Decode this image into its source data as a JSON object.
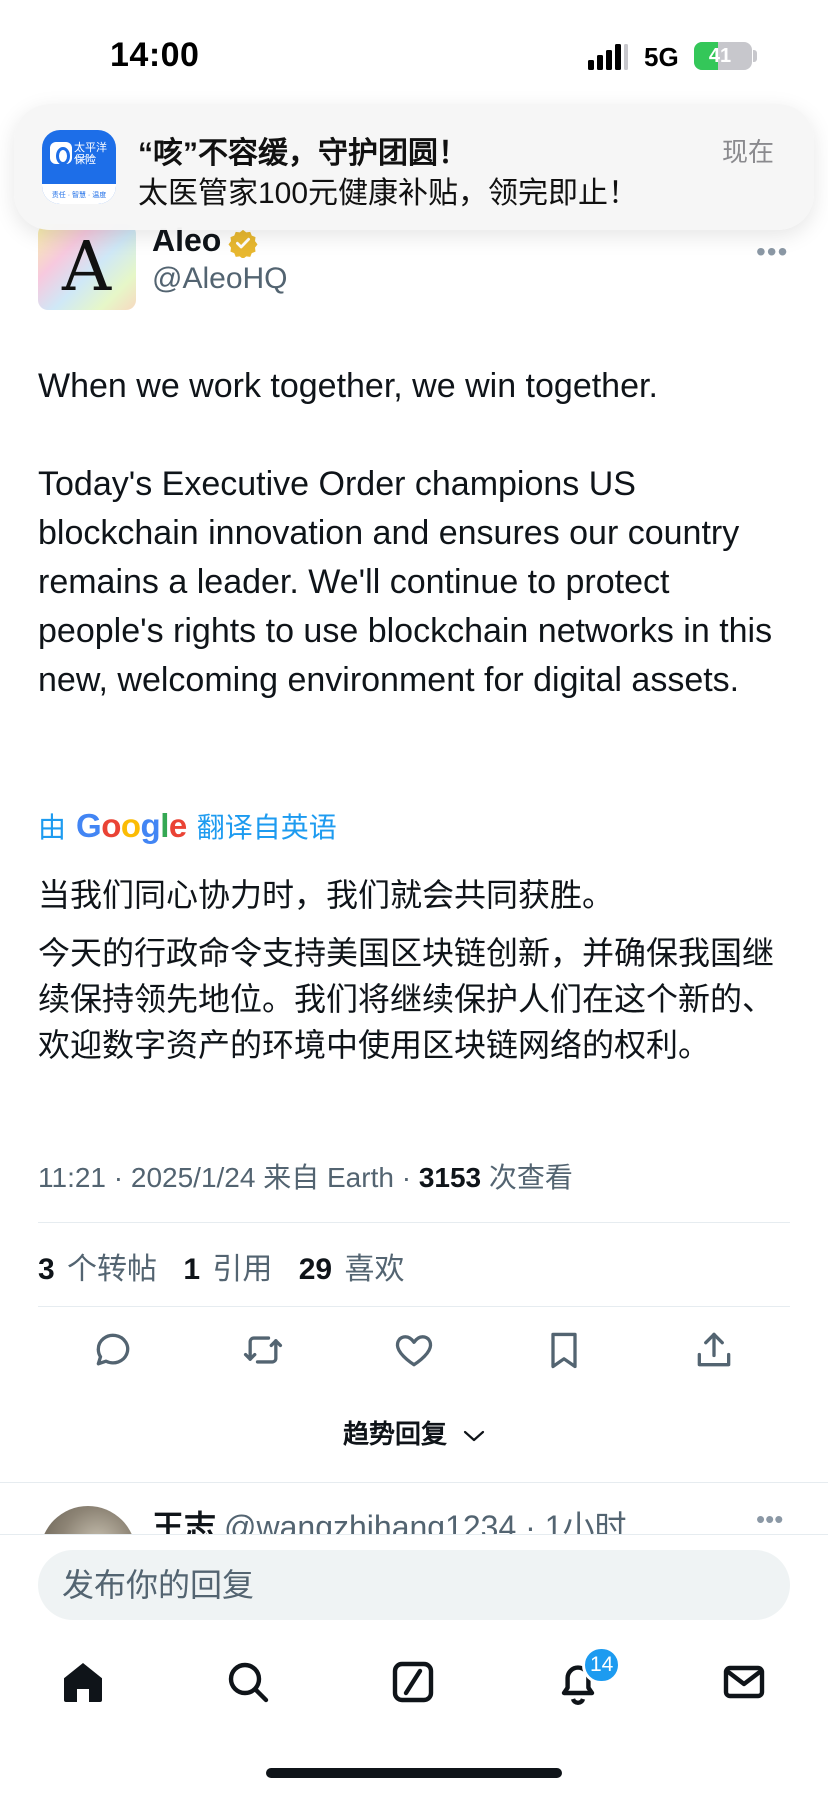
{
  "status_bar": {
    "time": "14:00",
    "network": "5G",
    "battery": "41",
    "battery_level_percent": 41
  },
  "notification": {
    "app_icon": {
      "name": "太平洋保险",
      "sub": "CPIC",
      "tagline": "责任 · 智慧 · 温度"
    },
    "title": "“咳”不容缓，守护团圆！",
    "body": "太医管家100元健康补贴，领完即止！",
    "time": "现在"
  },
  "tweet": {
    "avatar_letter": "A",
    "display_name": "Aleo",
    "handle": "@AleoHQ",
    "more_icon": "more-horizontal-icon",
    "text_paragraphs": [
      "When we work together, we win together.",
      "Today's Executive Order champions US blockchain innovation and ensures our country remains a leader. We'll continue to protect people's rights to use blockchain networks in this new, welcoming environment for digital assets."
    ],
    "translate": {
      "prefix": "由",
      "brand": "Google",
      "suffix": "翻译自英语"
    },
    "translated_paragraphs": [
      "当我们同心协力时，我们就会共同获胜。",
      "今天的行政命令支持美国区块链创新，并确保我国继续保持领先地位。我们将继续保护人们在这个新的、欢迎数字资产的环境中使用区块链网络的权利。"
    ],
    "meta": {
      "time_date": "11:21 · 2025/1/24 来自 Earth · ",
      "views_count": "3153",
      "views_label": " 次查看"
    },
    "stats": {
      "reposts_count": "3",
      "reposts_label": "个转帖",
      "quotes_count": "1",
      "quotes_label": "引用",
      "likes_count": "29",
      "likes_label": "喜欢"
    },
    "actions": [
      "reply-icon",
      "repost-icon",
      "like-icon",
      "bookmark-icon",
      "share-icon"
    ]
  },
  "replies_sort": {
    "label": "趋势回复"
  },
  "reply_preview": {
    "name": "王志",
    "handle_time": "@wangzhihang1234 · 1小时"
  },
  "composer": {
    "placeholder": "发布你的回复"
  },
  "tab_bar": {
    "items": [
      "home-icon",
      "search-icon",
      "grok-icon",
      "notifications-icon",
      "messages-icon"
    ],
    "notifications_badge": "14"
  },
  "colors": {
    "accent": "#1d9bf0",
    "text_primary": "#0f1419",
    "text_secondary": "#536471",
    "verified_gold": "#e8b830",
    "battery_green": "#34c759"
  }
}
